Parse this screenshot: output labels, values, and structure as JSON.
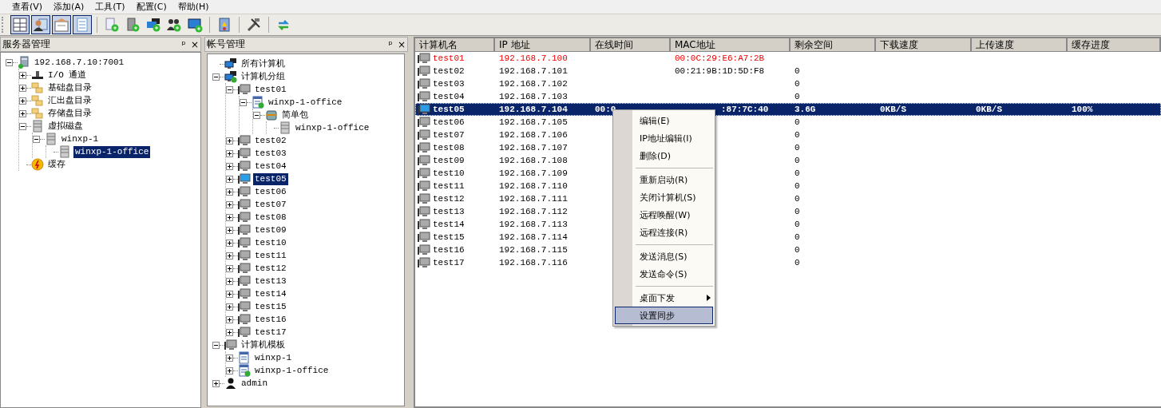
{
  "menu_bar": [
    {
      "label": "查看(V)"
    },
    {
      "label": "添加(A)"
    },
    {
      "label": "工具(T)"
    },
    {
      "label": "配置(C)"
    },
    {
      "label": "帮助(H)"
    }
  ],
  "toolbar": [
    {
      "kind": "grid",
      "selected": true
    },
    {
      "kind": "person",
      "selected": true
    },
    {
      "kind": "card",
      "selected": true
    },
    {
      "kind": "page",
      "selected": true
    },
    {
      "kind": "sep"
    },
    {
      "kind": "doc_add",
      "selected": false
    },
    {
      "kind": "server_add",
      "selected": false
    },
    {
      "kind": "monitors_add",
      "selected": false
    },
    {
      "kind": "users_add",
      "selected": false
    },
    {
      "kind": "monitor_add",
      "selected": false
    },
    {
      "kind": "sep"
    },
    {
      "kind": "book",
      "selected": false
    },
    {
      "kind": "sep"
    },
    {
      "kind": "tools",
      "selected": false
    },
    {
      "kind": "sep"
    },
    {
      "kind": "sync",
      "selected": false
    }
  ],
  "server_panel": {
    "title": "服务器管理",
    "pin": "ᵖ",
    "close": "×",
    "tree": [
      {
        "label": "192.168.7.10:7001",
        "kind": "server",
        "expanded": true,
        "selected": false,
        "children": [
          {
            "label": "I/O 通道",
            "kind": "io",
            "expanded": false,
            "selected": false
          },
          {
            "label": "基础盘目录",
            "kind": "folder",
            "expanded": false,
            "selected": false
          },
          {
            "label": "汇出盘目录",
            "kind": "folder",
            "expanded": false,
            "selected": false
          },
          {
            "label": "存储盘目录",
            "kind": "folder",
            "expanded": false,
            "selected": false
          },
          {
            "label": "虚拟磁盘",
            "kind": "disk",
            "expanded": true,
            "selected": false,
            "children": [
              {
                "label": "winxp-1",
                "kind": "disk",
                "expanded": true,
                "selected": false,
                "children": [
                  {
                    "label": "winxp-1-office",
                    "kind": "disk",
                    "selected": true
                  }
                ]
              }
            ]
          },
          {
            "label": "缓存",
            "kind": "cache",
            "selected": false
          }
        ]
      }
    ]
  },
  "account_panel": {
    "title": "帐号管理",
    "pin": "ᵖ",
    "close": "×",
    "tree": [
      {
        "label": "所有计算机",
        "kind": "network",
        "selected": false
      },
      {
        "label": "计算机分组",
        "kind": "network_check",
        "expanded": true,
        "selected": false,
        "children": [
          {
            "label": "test01",
            "kind": "pc",
            "expanded": true,
            "selected": false,
            "children": [
              {
                "label": "winxp-1-office",
                "kind": "doc_check",
                "expanded": true,
                "selected": false,
                "children": [
                  {
                    "label": "简单包",
                    "kind": "package",
                    "expanded": true,
                    "selected": false,
                    "children": [
                      {
                        "label": "winxp-1-office",
                        "kind": "disk",
                        "selected": false
                      }
                    ]
                  }
                ]
              }
            ]
          },
          {
            "label": "test02",
            "kind": "pc",
            "expanded": false,
            "selected": false
          },
          {
            "label": "test03",
            "kind": "pc",
            "expanded": false,
            "selected": false
          },
          {
            "label": "test04",
            "kind": "pc",
            "expanded": false,
            "selected": false
          },
          {
            "label": "test05",
            "kind": "pc_online",
            "expanded": false,
            "selected": true
          },
          {
            "label": "test06",
            "kind": "pc",
            "expanded": false,
            "selected": false
          },
          {
            "label": "test07",
            "kind": "pc",
            "expanded": false,
            "selected": false
          },
          {
            "label": "test08",
            "kind": "pc",
            "expanded": false,
            "selected": false
          },
          {
            "label": "test09",
            "kind": "pc",
            "expanded": false,
            "selected": false
          },
          {
            "label": "test10",
            "kind": "pc",
            "expanded": false,
            "selected": false
          },
          {
            "label": "test11",
            "kind": "pc",
            "expanded": false,
            "selected": false
          },
          {
            "label": "test12",
            "kind": "pc",
            "expanded": false,
            "selected": false
          },
          {
            "label": "test13",
            "kind": "pc",
            "expanded": false,
            "selected": false
          },
          {
            "label": "test14",
            "kind": "pc",
            "expanded": false,
            "selected": false
          },
          {
            "label": "test15",
            "kind": "pc",
            "expanded": false,
            "selected": false
          },
          {
            "label": "test16",
            "kind": "pc",
            "expanded": false,
            "selected": false
          },
          {
            "label": "test17",
            "kind": "pc",
            "expanded": false,
            "selected": false
          }
        ]
      },
      {
        "label": "计算机模板",
        "kind": "pc",
        "expanded": true,
        "selected": false,
        "children": [
          {
            "label": "winxp-1",
            "kind": "doc",
            "expanded": false,
            "selected": false
          },
          {
            "label": "winxp-1-office",
            "kind": "doc_check",
            "expanded": false,
            "selected": false
          }
        ]
      },
      {
        "label": "admin",
        "kind": "user",
        "expanded": false,
        "selected": false
      }
    ]
  },
  "table": {
    "columns": [
      "计算机名",
      "IP 地址",
      "在线时间",
      "MAC地址",
      "剩余空间",
      "下载速度",
      "上传速度",
      "缓存进度"
    ],
    "rows": [
      {
        "name": "test01",
        "ip": "192.168.7.100",
        "mac": "00:0C:29:E6:A7:2B",
        "alert": true,
        "online": false,
        "selected": false
      },
      {
        "name": "test02",
        "ip": "192.168.7.101",
        "mac": "00:21:9B:1D:5D:F8",
        "free": "0",
        "alert": false,
        "online": false,
        "selected": false
      },
      {
        "name": "test03",
        "ip": "192.168.7.102",
        "free": "0",
        "alert": false,
        "online": false,
        "selected": false
      },
      {
        "name": "test04",
        "ip": "192.168.7.103",
        "free": "0",
        "alert": false,
        "online": false,
        "selected": false
      },
      {
        "name": "test05",
        "ip": "192.168.7.104",
        "online_time": "00:0",
        "mac": ":87:7C:40",
        "free": "3.6G",
        "download": "0KB/S",
        "upload": "0KB/S",
        "cache": "100%",
        "alert": false,
        "online": true,
        "selected": true
      },
      {
        "name": "test06",
        "ip": "192.168.7.105",
        "free": "0",
        "alert": false,
        "online": false,
        "selected": false
      },
      {
        "name": "test07",
        "ip": "192.168.7.106",
        "free": "0",
        "alert": false,
        "online": false,
        "selected": false
      },
      {
        "name": "test08",
        "ip": "192.168.7.107",
        "free": "0",
        "alert": false,
        "online": false,
        "selected": false
      },
      {
        "name": "test09",
        "ip": "192.168.7.108",
        "free": "0",
        "alert": false,
        "online": false,
        "selected": false
      },
      {
        "name": "test10",
        "ip": "192.168.7.109",
        "free": "0",
        "alert": false,
        "online": false,
        "selected": false
      },
      {
        "name": "test11",
        "ip": "192.168.7.110",
        "free": "0",
        "alert": false,
        "online": false,
        "selected": false
      },
      {
        "name": "test12",
        "ip": "192.168.7.111",
        "free": "0",
        "alert": false,
        "online": false,
        "selected": false
      },
      {
        "name": "test13",
        "ip": "192.168.7.112",
        "free": "0",
        "alert": false,
        "online": false,
        "selected": false
      },
      {
        "name": "test14",
        "ip": "192.168.7.113",
        "free": "0",
        "alert": false,
        "online": false,
        "selected": false
      },
      {
        "name": "test15",
        "ip": "192.168.7.114",
        "free": "0",
        "alert": false,
        "online": false,
        "selected": false
      },
      {
        "name": "test16",
        "ip": "192.168.7.115",
        "free": "0",
        "alert": false,
        "online": false,
        "selected": false
      },
      {
        "name": "test17",
        "ip": "192.168.7.116",
        "free": "0",
        "alert": false,
        "online": false,
        "selected": false
      }
    ]
  },
  "context_menu": [
    {
      "kind": "item",
      "label": "编辑(E)",
      "selected": false
    },
    {
      "kind": "item",
      "label": "IP地址编辑(I)",
      "selected": false
    },
    {
      "kind": "item",
      "label": "删除(D)",
      "selected": false
    },
    {
      "kind": "separator"
    },
    {
      "kind": "item",
      "label": "重新启动(R)",
      "selected": false
    },
    {
      "kind": "item",
      "label": "关闭计算机(S)",
      "selected": false
    },
    {
      "kind": "item",
      "label": "远程唤醒(W)",
      "selected": false
    },
    {
      "kind": "item",
      "label": "远程连接(R)",
      "selected": false
    },
    {
      "kind": "separator"
    },
    {
      "kind": "item",
      "label": "发送消息(S)",
      "selected": false
    },
    {
      "kind": "item",
      "label": "发送命令(S)",
      "selected": false
    },
    {
      "kind": "separator"
    },
    {
      "kind": "submenu",
      "label": "桌面下发",
      "selected": false
    },
    {
      "kind": "item",
      "label": "设置同步",
      "selected": true
    }
  ]
}
